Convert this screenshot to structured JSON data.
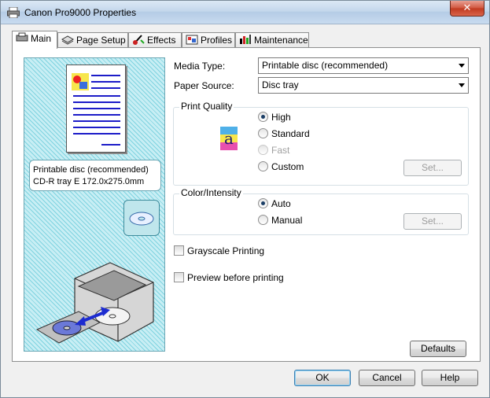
{
  "window": {
    "title": "Canon Pro9000 Properties",
    "close_label": "✕"
  },
  "tabs": [
    {
      "label": "Main",
      "icon": "main-tab-icon",
      "active": true
    },
    {
      "label": "Page Setup",
      "icon": "page-setup-icon"
    },
    {
      "label": "Effects",
      "icon": "effects-icon"
    },
    {
      "label": "Profiles",
      "icon": "profiles-icon"
    },
    {
      "label": "Maintenance",
      "icon": "maintenance-icon"
    }
  ],
  "preview": {
    "line1": "Printable disc (recommended)",
    "line2": "CD-R tray E 172.0x275.0mm"
  },
  "media_type": {
    "label": "Media Type:",
    "value": "Printable disc (recommended)"
  },
  "paper_source": {
    "label": "Paper Source:",
    "value": "Disc tray"
  },
  "print_quality": {
    "title": "Print Quality",
    "options": [
      "High",
      "Standard",
      "Fast",
      "Custom"
    ],
    "selected": "High",
    "set_label": "Set..."
  },
  "color_intensity": {
    "title": "Color/Intensity",
    "options": [
      "Auto",
      "Manual"
    ],
    "selected": "Auto",
    "set_label": "Set..."
  },
  "grayscale_label": "Grayscale Printing",
  "preview_label": "Preview before printing",
  "defaults_label": "Defaults",
  "footer": {
    "ok": "OK",
    "cancel": "Cancel",
    "help": "Help"
  },
  "colors": {
    "accent": "#1c1cc8",
    "preview_bg": "#c8eef4"
  }
}
